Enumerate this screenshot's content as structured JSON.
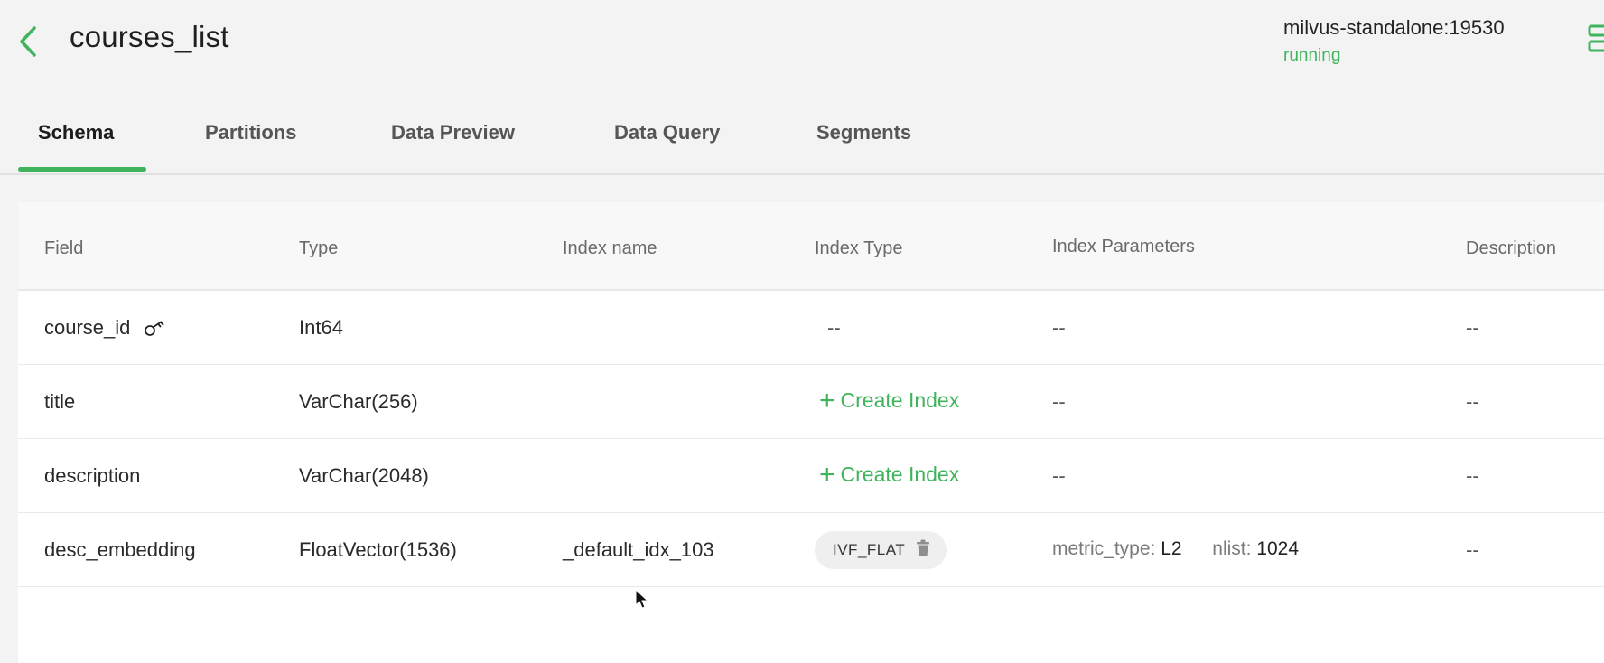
{
  "header": {
    "title": "courses_list",
    "server": "milvus-standalone:19530",
    "status": "running"
  },
  "tabs": [
    {
      "label": "Schema",
      "active": true
    },
    {
      "label": "Partitions"
    },
    {
      "label": "Data Preview"
    },
    {
      "label": "Data Query"
    },
    {
      "label": "Segments"
    }
  ],
  "table": {
    "columns": [
      "Field",
      "Type",
      "Index name",
      "Index Type",
      "Index Parameters",
      "Description"
    ],
    "rows": [
      {
        "field": "course_id",
        "type": "Int64",
        "index_name": "",
        "index_type": "--",
        "params": "--",
        "description": "--"
      },
      {
        "field": "title",
        "type": "VarChar(256)",
        "index_name": "",
        "create_index": "Create Index",
        "params": "--",
        "description": "--"
      },
      {
        "field": "description",
        "type": "VarChar(2048)",
        "index_name": "",
        "create_index": "Create Index",
        "params": "--",
        "description": "--"
      },
      {
        "field": "desc_embedding",
        "type": "FloatVector(1536)",
        "index_name": "_default_idx_103",
        "index_type": "IVF_FLAT",
        "params": {
          "metric_type_key": "metric_type:",
          "metric_type_value": "L2",
          "nlist_key": "nlist:",
          "nlist_value": "1024"
        },
        "description": "--"
      }
    ]
  },
  "colors": {
    "accent": "#3fb45c",
    "background": "#f3f3f3",
    "card": "#ffffff"
  }
}
